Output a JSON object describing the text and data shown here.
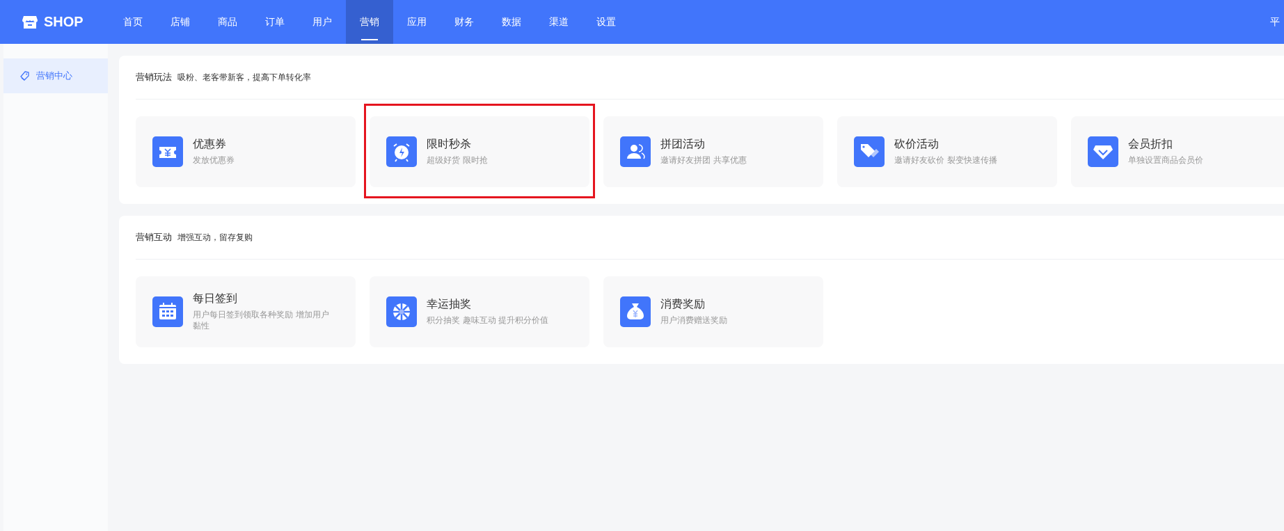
{
  "header": {
    "logo": "SHOP",
    "nav": [
      {
        "label": "首页",
        "selected": false
      },
      {
        "label": "店铺",
        "selected": false
      },
      {
        "label": "商品",
        "selected": false
      },
      {
        "label": "订单",
        "selected": false
      },
      {
        "label": "用户",
        "selected": false
      },
      {
        "label": "营销",
        "selected": true
      },
      {
        "label": "应用",
        "selected": false
      },
      {
        "label": "财务",
        "selected": false
      },
      {
        "label": "数据",
        "selected": false
      },
      {
        "label": "渠道",
        "selected": false
      },
      {
        "label": "设置",
        "selected": false
      }
    ],
    "right_text": "平"
  },
  "sidebar": {
    "items": [
      {
        "label": "营销中心",
        "selected": true
      }
    ]
  },
  "sections": [
    {
      "title": "营销玩法",
      "subtitle": "吸粉、老客带新客，提高下单转化率",
      "cards": [
        {
          "title": "优惠券",
          "description": "发放优惠券",
          "highlighted": false
        },
        {
          "title": "限时秒杀",
          "description": "超级好货 限时抢",
          "highlighted": true
        },
        {
          "title": "拼团活动",
          "description": "邀请好友拼团 共享优惠",
          "highlighted": false
        },
        {
          "title": "砍价活动",
          "description": "邀请好友砍价 裂变快速传播",
          "highlighted": false
        },
        {
          "title": "会员折扣",
          "description": "单独设置商品会员价",
          "highlighted": false
        }
      ]
    },
    {
      "title": "营销互动",
      "subtitle": "增强互动，留存复购",
      "cards": [
        {
          "title": "每日签到",
          "description": "用户每日签到领取各种奖励 增加用户黏性",
          "highlighted": false
        },
        {
          "title": "幸运抽奖",
          "description": "积分抽奖 趣味互动 提升积分价值",
          "highlighted": false
        },
        {
          "title": "消费奖励",
          "description": "用户消费赠送奖励",
          "highlighted": false
        }
      ]
    }
  ]
}
